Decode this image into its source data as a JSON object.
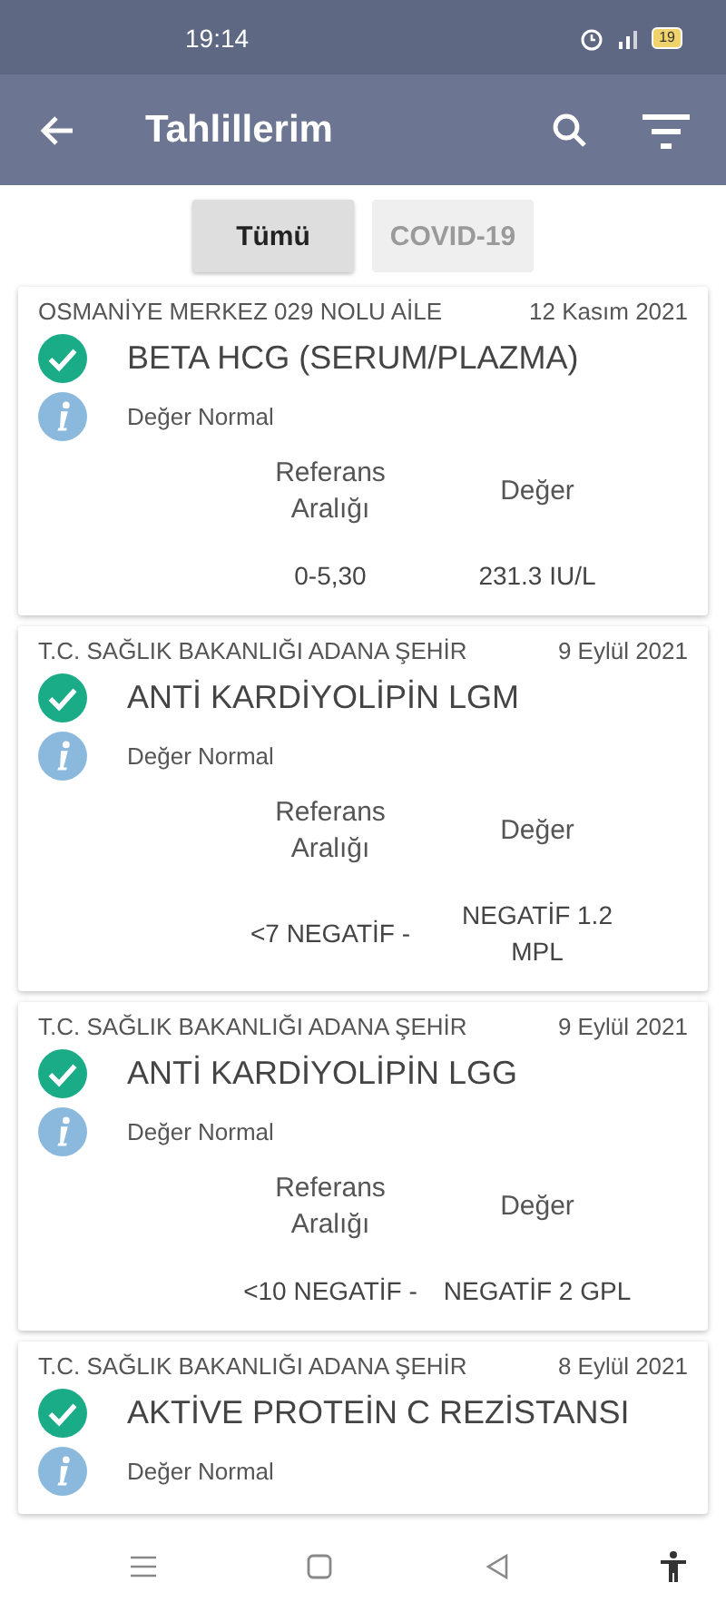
{
  "status_bar": {
    "time": "19:14",
    "battery": "19"
  },
  "app_bar": {
    "title": "Tahlillerim"
  },
  "tabs": [
    {
      "label": "Tümü",
      "selected": true
    },
    {
      "label": "COVID-19",
      "selected": false
    }
  ],
  "results": [
    {
      "institution": "OSMANİYE MERKEZ 029 NOLU AİLE",
      "date": "12 Kasım 2021",
      "test": "BETA HCG (SERUM/PLAZMA)",
      "status": "Değer Normal",
      "normal": true,
      "reference_header": "Referans Aralığı",
      "value_header": "Değer",
      "reference": "0-5,30",
      "value": "231.3 IU/L"
    },
    {
      "institution": "T.C. SAĞLIK BAKANLIĞI ADANA ŞEHİR",
      "date": "9 Eylül 2021",
      "test": "ANTİ KARDİYOLİPİN LGM",
      "status": "Değer Normal",
      "normal": true,
      "reference_header": "Referans Aralığı",
      "value_header": "Değer",
      "reference": "<7 NEGATİF -",
      "value": "NEGATİF 1.2 MPL"
    },
    {
      "institution": "T.C. SAĞLIK BAKANLIĞI ADANA ŞEHİR",
      "date": "9 Eylül 2021",
      "test": "ANTİ KARDİYOLİPİN LGG",
      "status": "Değer Normal",
      "normal": true,
      "reference_header": "Referans Aralığı",
      "value_header": "Değer",
      "reference": "<10 NEGATİF -",
      "value": "NEGATİF 2 GPL"
    },
    {
      "institution": "T.C. SAĞLIK BAKANLIĞI ADANA ŞEHİR",
      "date": "8 Eylül 2021",
      "test": "AKTİVE PROTEİN C REZİSTANSI",
      "status": "Değer Normal",
      "normal": true
    }
  ]
}
